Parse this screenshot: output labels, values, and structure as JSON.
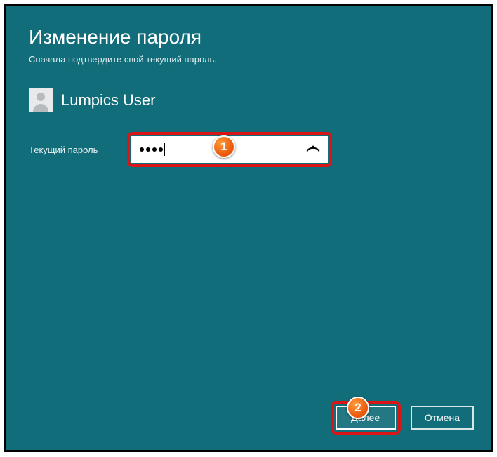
{
  "header": {
    "title": "Изменение пароля",
    "subtitle": "Сначала подтвердите свой текущий пароль."
  },
  "user": {
    "name": "Lumpics User"
  },
  "field": {
    "label": "Текущий пароль",
    "masked_value": "••••"
  },
  "callouts": {
    "one": "1",
    "two": "2"
  },
  "footer": {
    "next": "Далее",
    "cancel": "Отмена"
  }
}
